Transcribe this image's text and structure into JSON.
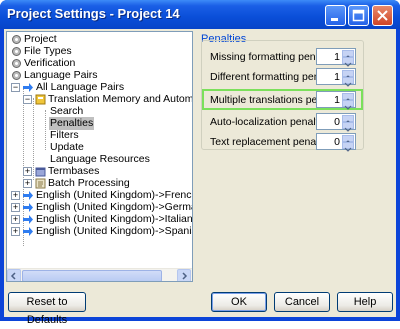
{
  "window": {
    "title": "Project Settings - Project 14"
  },
  "tree": {
    "items": [
      {
        "label": "Project",
        "icon": "gear-icon"
      },
      {
        "label": "File Types",
        "icon": "gear-icon"
      },
      {
        "label": "Verification",
        "icon": "gear-icon"
      },
      {
        "label": "Language Pairs",
        "icon": "gear-icon"
      },
      {
        "label": "All Language Pairs",
        "icon": "arrow-icon"
      },
      {
        "label": "Translation Memory and Automated",
        "icon": "tm-book-icon"
      },
      {
        "label": "Search"
      },
      {
        "label": "Penalties"
      },
      {
        "label": "Filters"
      },
      {
        "label": "Update"
      },
      {
        "label": "Language Resources"
      },
      {
        "label": "Termbases",
        "icon": "termbase-icon"
      },
      {
        "label": "Batch Processing",
        "icon": "batch-icon"
      },
      {
        "label": "English (United Kingdom)->French (Fran",
        "icon": "arrow-icon"
      },
      {
        "label": "English (United Kingdom)->German (Ger",
        "icon": "arrow-icon"
      },
      {
        "label": "English (United Kingdom)->Italian (Italy)",
        "icon": "arrow-icon"
      },
      {
        "label": "English (United Kingdom)->Spanish (Spa",
        "icon": "arrow-icon"
      }
    ]
  },
  "panel": {
    "title": "Penalties",
    "fields": [
      {
        "label": "Missing formatting penalty:",
        "value": "1"
      },
      {
        "label": "Different formatting penalty:",
        "value": "1"
      },
      {
        "label": "Multiple translations penalty:",
        "value": "1"
      },
      {
        "label": "Auto-localization penalty:",
        "value": "0"
      },
      {
        "label": "Text replacement penalty:",
        "value": "0"
      }
    ]
  },
  "buttons": {
    "reset": "Reset to Defaults",
    "ok": "OK",
    "cancel": "Cancel",
    "help": "Help"
  },
  "colors": {
    "accent": "#0046d5",
    "highlight": "#7be05b",
    "titlebar": "#0a4ed8"
  }
}
